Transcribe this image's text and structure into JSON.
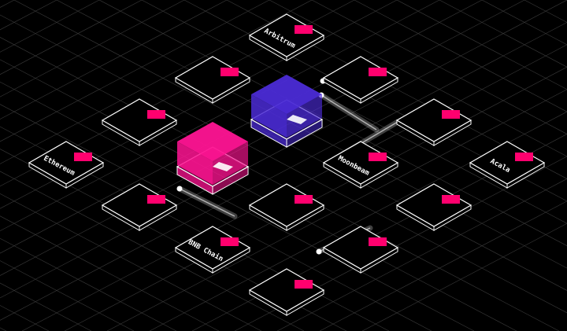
{
  "colors": {
    "background": "#000000",
    "grid": "#3a3a3a",
    "tile_stroke": "#ffffff",
    "chip": "#ff006e",
    "pink_block": "#ff1493",
    "purple_block": "#4b2bd6",
    "connector": "#ffffff"
  },
  "tiles": [
    {
      "id": "arbitrum",
      "label": "Arbitrum"
    },
    {
      "id": "ethereum",
      "label": "Ethereum"
    },
    {
      "id": "moonbeam",
      "label": "Moonbeam"
    },
    {
      "id": "acala",
      "label": "Acala"
    },
    {
      "id": "bnb",
      "label": "BNB Chain"
    },
    {
      "id": "blank-1",
      "label": ""
    },
    {
      "id": "blank-2",
      "label": ""
    },
    {
      "id": "blank-3",
      "label": ""
    },
    {
      "id": "blank-4",
      "label": ""
    },
    {
      "id": "blank-5",
      "label": ""
    },
    {
      "id": "blank-6",
      "label": ""
    },
    {
      "id": "blank-7",
      "label": ""
    },
    {
      "id": "blank-8",
      "label": ""
    },
    {
      "id": "blank-9",
      "label": ""
    }
  ],
  "blocks": [
    {
      "id": "pink-block",
      "color_key": "pink_block"
    },
    {
      "id": "purple-block",
      "color_key": "purple_block"
    }
  ],
  "connectors": 4
}
